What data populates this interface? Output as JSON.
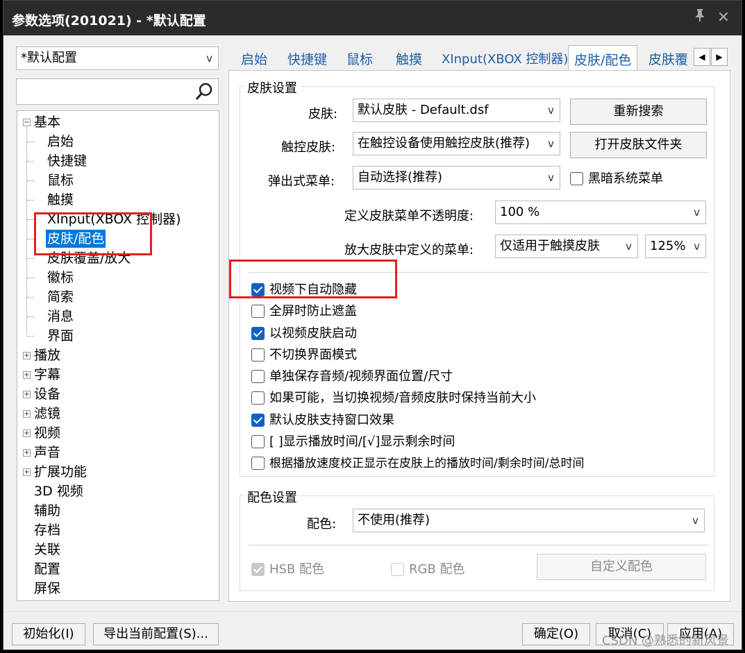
{
  "window": {
    "title": "参数选项(201021) - *默认配置",
    "pin_icon": "pin-icon",
    "close_icon": "close-icon"
  },
  "profile_combo": {
    "value": "*默认配置"
  },
  "search": {
    "placeholder": "",
    "icon": "search-icon"
  },
  "tree": {
    "basic": "基本",
    "basic_children": [
      "启始",
      "快捷键",
      "鼠标",
      "触摸",
      "XInput(XBOX 控制器)",
      "皮肤/配色",
      "皮肤覆盖/放大",
      "徽标",
      "简索",
      "消息",
      "界面"
    ],
    "groups": [
      "播放",
      "字幕",
      "设备",
      "滤镜",
      "视频",
      "声音",
      "扩展功能"
    ],
    "leaves": [
      "3D 视频",
      "辅助",
      "存档",
      "关联",
      "配置",
      "屏保"
    ],
    "selected": "皮肤/配色"
  },
  "tabs": {
    "items": [
      "启始",
      "快捷键",
      "鼠标",
      "触摸",
      "XInput(XBOX 控制器)",
      "皮肤/配色",
      "皮肤覆"
    ],
    "active": "皮肤/配色"
  },
  "skin_settings": {
    "group_title": "皮肤设置",
    "skin_label": "皮肤:",
    "skin_value": "默认皮肤 - Default.dsf",
    "research_button": "重新搜索",
    "touch_skin_label": "触控皮肤:",
    "touch_skin_value": "在触控设备使用触控皮肤(推荐)",
    "open_folder_button": "打开皮肤文件夹",
    "popup_menu_label": "弹出式菜单:",
    "popup_menu_value": "自动选择(推荐)",
    "dark_menu_label": "黑暗系统菜单",
    "opacity_label": "定义皮肤菜单不透明度:",
    "opacity_value": "100 %",
    "zoom_menu_label": "放大皮肤中定义的菜单:",
    "zoom_menu_value": "仅适用于触摸皮肤",
    "zoom_percent_value": "125%",
    "checkboxes": [
      {
        "label": "视频下自动隐藏",
        "checked": true
      },
      {
        "label": "全屏时防止遮盖",
        "checked": false
      },
      {
        "label": "以视频皮肤启动",
        "checked": true
      },
      {
        "label": "不切换界面模式",
        "checked": false
      },
      {
        "label": "单独保存音频/视频界面位置/尺寸",
        "checked": false
      },
      {
        "label": "如果可能，当切换视频/音频皮肤时保持当前大小",
        "checked": false
      },
      {
        "label": "默认皮肤支持窗口效果",
        "checked": true
      },
      {
        "label": "[ ]显示播放时间/[√]显示剩余时间",
        "checked": false
      },
      {
        "label": "根据播放速度校正显示在皮肤上的播放时间/剩余时间/总时间",
        "checked": false
      }
    ]
  },
  "color_settings": {
    "group_title": "配色设置",
    "color_label": "配色:",
    "color_value": "不使用(推荐)",
    "hsb_label": "HSB 配色",
    "rgb_label": "RGB 配色",
    "custom_button": "自定义配色"
  },
  "bottom": {
    "init_button": "初始化(I)",
    "export_button": "导出当前配置(S)...",
    "ok_button": "确定(O)",
    "cancel_button": "取消(C)",
    "apply_button": "应用(A)"
  },
  "watermark": "CSDN @熟悉的新风景",
  "colors": {
    "accent": "#0078d7",
    "highlight_box": "#e02020",
    "tab_text": "#1c5fa6",
    "titlebar": "#2b2b2b"
  }
}
